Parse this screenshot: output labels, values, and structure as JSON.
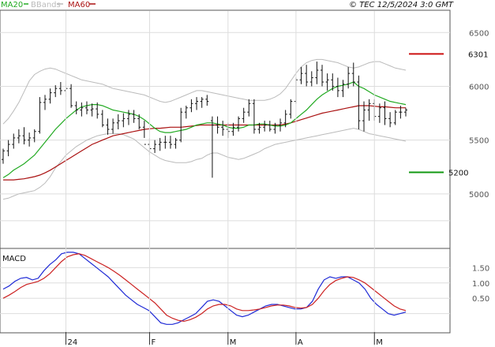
{
  "header": {
    "legend": [
      {
        "name": "MA20",
        "color": "#22aa22"
      },
      {
        "name": "BBands",
        "color": "#bbbbbb"
      },
      {
        "name": "MA60",
        "color": "#aa1111"
      }
    ],
    "credit": "© TEC 12/5/2024 3:0 GMT"
  },
  "macd_panel": {
    "title": "MACD"
  },
  "chart_data": [
    {
      "type": "line",
      "panel": "price",
      "ylim": [
        4500,
        6700
      ],
      "yticks": [
        5000,
        5500,
        6000,
        6500
      ],
      "ytick_labels": [
        "5000",
        "5500",
        "6000",
        "6500"
      ],
      "xticks": [
        {
          "label": "24",
          "index": 12
        },
        {
          "label": "F",
          "index": 28
        },
        {
          "label": "M",
          "index": 43
        },
        {
          "label": "A",
          "index": 56
        },
        {
          "label": "M",
          "index": 71
        }
      ],
      "colors": {
        "bar": "#111111",
        "ma20": "#22aa22",
        "ma60": "#aa1111",
        "bbands": "#bbbbbb"
      },
      "ohlc": [
        [
          5320,
          5420,
          5280,
          5400
        ],
        [
          5400,
          5500,
          5350,
          5460
        ],
        [
          5460,
          5560,
          5420,
          5520
        ],
        [
          5520,
          5600,
          5470,
          5540
        ],
        [
          5540,
          5620,
          5460,
          5500
        ],
        [
          5500,
          5570,
          5440,
          5520
        ],
        [
          5520,
          5600,
          5480,
          5580
        ],
        [
          5580,
          5900,
          5560,
          5850
        ],
        [
          5850,
          5920,
          5780,
          5880
        ],
        [
          5880,
          5980,
          5840,
          5940
        ],
        [
          5940,
          6010,
          5900,
          5980
        ],
        [
          5980,
          6040,
          5920,
          5960
        ],
        [
          5960,
          6050,
          5900,
          5980
        ],
        [
          5980,
          6020,
          5800,
          5820
        ],
        [
          5820,
          5860,
          5740,
          5780
        ],
        [
          5780,
          5850,
          5720,
          5800
        ],
        [
          5800,
          5860,
          5740,
          5780
        ],
        [
          5780,
          5840,
          5720,
          5790
        ],
        [
          5790,
          5850,
          5700,
          5740
        ],
        [
          5740,
          5780,
          5620,
          5640
        ],
        [
          5640,
          5700,
          5550,
          5600
        ],
        [
          5600,
          5700,
          5560,
          5660
        ],
        [
          5660,
          5740,
          5600,
          5680
        ],
        [
          5680,
          5750,
          5620,
          5700
        ],
        [
          5700,
          5780,
          5640,
          5740
        ],
        [
          5740,
          5780,
          5660,
          5700
        ],
        [
          5700,
          5740,
          5600,
          5620
        ],
        [
          5620,
          5680,
          5520,
          5460
        ],
        [
          5460,
          5520,
          5360,
          5420
        ],
        [
          5420,
          5500,
          5380,
          5460
        ],
        [
          5460,
          5520,
          5400,
          5480
        ],
        [
          5480,
          5540,
          5420,
          5480
        ],
        [
          5480,
          5540,
          5420,
          5460
        ],
        [
          5460,
          5520,
          5420,
          5500
        ],
        [
          5500,
          5800,
          5480,
          5760
        ],
        [
          5760,
          5820,
          5700,
          5800
        ],
        [
          5800,
          5880,
          5760,
          5840
        ],
        [
          5840,
          5900,
          5780,
          5860
        ],
        [
          5860,
          5900,
          5800,
          5880
        ],
        [
          5880,
          5920,
          5820,
          5860
        ],
        [
          5680,
          5720,
          5150,
          5640
        ],
        [
          5640,
          5720,
          5560,
          5620
        ],
        [
          5620,
          5680,
          5540,
          5600
        ],
        [
          5600,
          5660,
          5520,
          5580
        ],
        [
          5580,
          5660,
          5540,
          5620
        ],
        [
          5620,
          5720,
          5580,
          5700
        ],
        [
          5700,
          5800,
          5660,
          5760
        ],
        [
          5760,
          5880,
          5720,
          5840
        ],
        [
          5840,
          5880,
          5560,
          5600
        ],
        [
          5600,
          5660,
          5560,
          5620
        ],
        [
          5620,
          5680,
          5580,
          5640
        ],
        [
          5640,
          5680,
          5580,
          5600
        ],
        [
          5600,
          5660,
          5560,
          5640
        ],
        [
          5640,
          5700,
          5580,
          5660
        ],
        [
          5660,
          5780,
          5620,
          5740
        ],
        [
          5740,
          5880,
          5700,
          5860
        ],
        [
          5860,
          6080,
          5840,
          6060
        ],
        [
          6060,
          6180,
          6020,
          6120
        ],
        [
          6120,
          6200,
          6000,
          6040
        ],
        [
          6040,
          6140,
          6000,
          6080
        ],
        [
          6080,
          6230,
          6020,
          6150
        ],
        [
          6150,
          6200,
          6000,
          6040
        ],
        [
          6040,
          6120,
          5960,
          6060
        ],
        [
          6060,
          6120,
          5960,
          6000
        ],
        [
          6000,
          6080,
          5900,
          5960
        ],
        [
          5960,
          6060,
          5900,
          6020
        ],
        [
          6020,
          6180,
          5980,
          6120
        ],
        [
          6120,
          6220,
          6000,
          6040
        ],
        [
          6040,
          6100,
          5600,
          5680
        ],
        [
          5680,
          5860,
          5580,
          5780
        ],
        [
          5780,
          5880,
          5680,
          5840
        ],
        [
          5840,
          5880,
          5680,
          5720
        ],
        [
          5720,
          5840,
          5660,
          5800
        ],
        [
          5800,
          5860,
          5640,
          5700
        ],
        [
          5700,
          5760,
          5620,
          5660
        ],
        [
          5660,
          5780,
          5640,
          5760
        ],
        [
          5760,
          5820,
          5700,
          5760
        ],
        [
          5760,
          5800,
          5720,
          5780
        ]
      ],
      "ma20": [
        5150,
        5180,
        5220,
        5250,
        5280,
        5320,
        5360,
        5420,
        5480,
        5540,
        5600,
        5650,
        5700,
        5740,
        5780,
        5810,
        5820,
        5830,
        5830,
        5820,
        5800,
        5780,
        5770,
        5760,
        5750,
        5740,
        5720,
        5690,
        5650,
        5610,
        5580,
        5570,
        5570,
        5580,
        5590,
        5600,
        5620,
        5640,
        5650,
        5660,
        5660,
        5650,
        5640,
        5620,
        5610,
        5610,
        5620,
        5640,
        5640,
        5650,
        5650,
        5640,
        5630,
        5630,
        5640,
        5660,
        5700,
        5740,
        5780,
        5830,
        5880,
        5920,
        5950,
        5980,
        6000,
        6010,
        6020,
        6040,
        6000,
        5980,
        5950,
        5920,
        5900,
        5880,
        5860,
        5850,
        5840,
        5830
      ],
      "ma60": [
        5130,
        5130,
        5130,
        5135,
        5140,
        5150,
        5160,
        5175,
        5195,
        5220,
        5250,
        5280,
        5310,
        5340,
        5370,
        5400,
        5430,
        5460,
        5480,
        5500,
        5520,
        5540,
        5550,
        5560,
        5570,
        5580,
        5590,
        5600,
        5605,
        5610,
        5610,
        5615,
        5620,
        5620,
        5620,
        5625,
        5630,
        5635,
        5640,
        5640,
        5640,
        5640,
        5640,
        5640,
        5640,
        5640,
        5640,
        5640,
        5640,
        5640,
        5640,
        5640,
        5640,
        5640,
        5650,
        5660,
        5675,
        5690,
        5705,
        5720,
        5735,
        5750,
        5760,
        5770,
        5780,
        5790,
        5800,
        5810,
        5820,
        5820,
        5820,
        5815,
        5810,
        5810,
        5805,
        5800,
        5800,
        5800
      ],
      "bb_upper": [
        5650,
        5700,
        5770,
        5850,
        5950,
        6050,
        6110,
        6140,
        6160,
        6170,
        6160,
        6140,
        6120,
        6100,
        6080,
        6060,
        6050,
        6040,
        6030,
        6020,
        6000,
        5980,
        5970,
        5960,
        5950,
        5940,
        5930,
        5920,
        5900,
        5880,
        5860,
        5850,
        5860,
        5880,
        5900,
        5920,
        5940,
        5960,
        5960,
        5950,
        5940,
        5930,
        5920,
        5910,
        5900,
        5890,
        5880,
        5870,
        5870,
        5870,
        5870,
        5880,
        5900,
        5930,
        5980,
        6050,
        6120,
        6180,
        6220,
        6240,
        6250,
        6250,
        6240,
        6230,
        6220,
        6200,
        6180,
        6170,
        6180,
        6200,
        6220,
        6230,
        6230,
        6210,
        6190,
        6170,
        6160,
        6150
      ],
      "bb_lower": [
        4950,
        4960,
        4980,
        5000,
        5010,
        5020,
        5030,
        5060,
        5100,
        5160,
        5240,
        5300,
        5360,
        5400,
        5440,
        5470,
        5500,
        5520,
        5540,
        5550,
        5560,
        5560,
        5560,
        5550,
        5530,
        5510,
        5470,
        5430,
        5390,
        5360,
        5330,
        5310,
        5300,
        5290,
        5290,
        5290,
        5300,
        5320,
        5330,
        5360,
        5380,
        5380,
        5360,
        5340,
        5330,
        5320,
        5330,
        5350,
        5370,
        5390,
        5420,
        5440,
        5460,
        5470,
        5480,
        5490,
        5500,
        5510,
        5520,
        5530,
        5540,
        5550,
        5560,
        5570,
        5580,
        5590,
        5600,
        5610,
        5600,
        5580,
        5560,
        5550,
        5540,
        5530,
        5520,
        5510,
        5500,
        5490
      ]
    },
    {
      "type": "line",
      "panel": "macd",
      "ylim": [
        -60,
        210
      ],
      "yticks": [
        50,
        100,
        150
      ],
      "ytick_labels": [
        "0.50",
        "1.00",
        "1.50"
      ],
      "series": [
        {
          "color": "#1f2ad6",
          "values": [
            80,
            90,
            105,
            115,
            118,
            110,
            115,
            140,
            160,
            175,
            195,
            200,
            200,
            195,
            180,
            165,
            150,
            135,
            120,
            100,
            80,
            60,
            45,
            30,
            20,
            10,
            -10,
            -30,
            -35,
            -35,
            -30,
            -20,
            -10,
            0,
            20,
            40,
            45,
            40,
            25,
            10,
            -5,
            -10,
            -5,
            5,
            15,
            25,
            30,
            30,
            25,
            20,
            15,
            15,
            20,
            40,
            80,
            110,
            120,
            115,
            120,
            120,
            110,
            100,
            80,
            50,
            30,
            15,
            0,
            -5,
            0,
            5
          ]
        },
        {
          "color": "#cc2222",
          "values": [
            50,
            60,
            72,
            85,
            95,
            100,
            105,
            115,
            130,
            150,
            170,
            185,
            192,
            195,
            190,
            180,
            170,
            160,
            150,
            138,
            125,
            110,
            95,
            80,
            65,
            50,
            35,
            15,
            -5,
            -15,
            -22,
            -25,
            -20,
            -12,
            0,
            15,
            25,
            30,
            30,
            25,
            15,
            10,
            10,
            12,
            15,
            20,
            25,
            28,
            28,
            25,
            20,
            18,
            20,
            30,
            50,
            75,
            95,
            108,
            115,
            120,
            118,
            110,
            100,
            85,
            70,
            55,
            40,
            25,
            15,
            10
          ]
        }
      ]
    }
  ],
  "levels": [
    {
      "value": 6301,
      "label": "6301",
      "color": "#cc1111"
    },
    {
      "value": 5200,
      "label": "5200",
      "color": "#119911"
    }
  ]
}
